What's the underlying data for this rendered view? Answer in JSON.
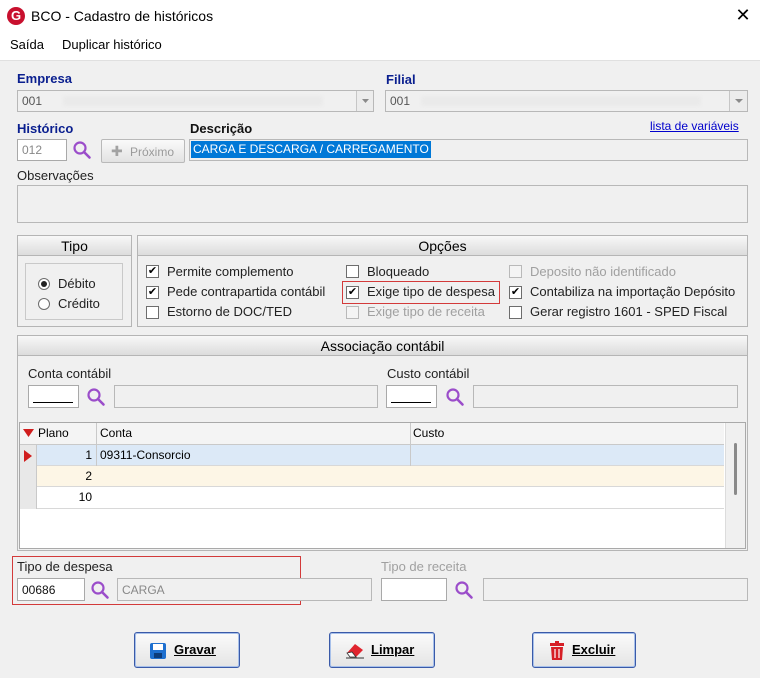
{
  "window": {
    "title": "BCO - Cadastro de históricos",
    "logo_letter": "G"
  },
  "menu": {
    "items": [
      "Saída",
      "Duplicar histórico"
    ]
  },
  "empresa": {
    "label": "Empresa",
    "value": "001"
  },
  "filial": {
    "label": "Filial",
    "value": "001"
  },
  "historico": {
    "label": "Histórico",
    "value": "012",
    "next_label": "Próximo"
  },
  "descricao": {
    "label": "Descrição",
    "value": "CARGA E DESCARGA / CARREGAMENTO"
  },
  "vars_link": "lista de variáveis",
  "observacoes": {
    "label": "Observações",
    "value": ""
  },
  "tipo": {
    "title": "Tipo",
    "options": [
      "Débito",
      "Crédito"
    ],
    "selected": "Débito"
  },
  "opcoes": {
    "title": "Opções",
    "items": [
      {
        "label": "Permite complemento",
        "checked": true,
        "enabled": true
      },
      {
        "label": "Pede contrapartida contábil",
        "checked": true,
        "enabled": true
      },
      {
        "label": "Estorno de DOC/TED",
        "checked": false,
        "enabled": true
      },
      {
        "label": "Bloqueado",
        "checked": false,
        "enabled": true
      },
      {
        "label": "Exige tipo de despesa",
        "checked": true,
        "enabled": true
      },
      {
        "label": "Exige tipo de receita",
        "checked": false,
        "enabled": false
      },
      {
        "label": "Deposito não identificado",
        "checked": false,
        "enabled": false
      },
      {
        "label": "Contabiliza na importação Depósito",
        "checked": true,
        "enabled": true
      },
      {
        "label": "Gerar registro 1601 - SPED Fiscal",
        "checked": false,
        "enabled": true
      }
    ]
  },
  "associacao": {
    "title": "Associação contábil",
    "conta_label": "Conta contábil",
    "custo_label": "Custo contábil",
    "columns": [
      "Plano",
      "Conta",
      "Custo"
    ],
    "rows": [
      {
        "plano": "1",
        "conta": "09311-Consorcio",
        "custo": ""
      },
      {
        "plano": "2",
        "conta": "",
        "custo": ""
      },
      {
        "plano": "10",
        "conta": "",
        "custo": ""
      }
    ]
  },
  "tipo_despesa": {
    "label": "Tipo de despesa",
    "code": "00686",
    "desc": "CARGA"
  },
  "tipo_receita": {
    "label": "Tipo de receita",
    "code": "",
    "desc": ""
  },
  "buttons": {
    "gravar": "Gravar",
    "limpar": "Limpar",
    "excluir": "Excluir"
  },
  "colors": {
    "accent_blue": "#0a1f8f",
    "highlight_red": "#d33a3a",
    "selection": "#0078d7"
  }
}
